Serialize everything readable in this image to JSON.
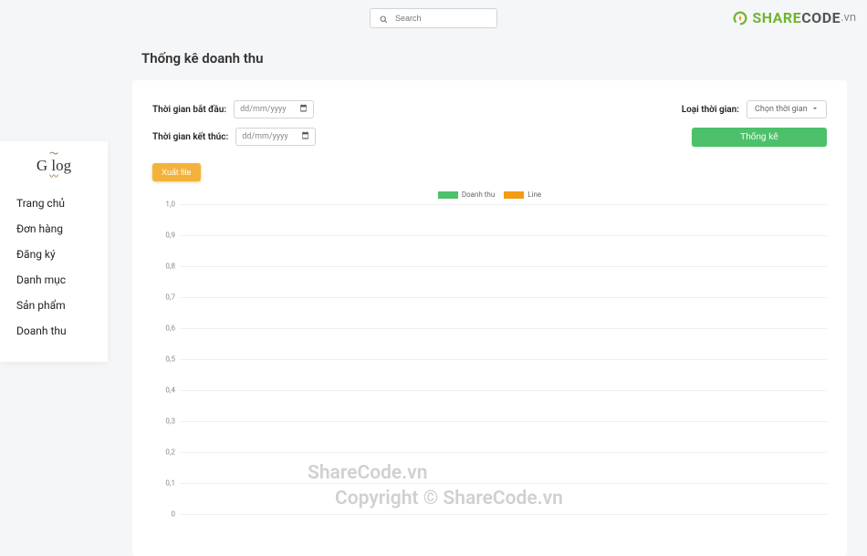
{
  "search": {
    "placeholder": "Search"
  },
  "brand": {
    "share": "SHARE",
    "code": "CODE",
    "vn": ".vn"
  },
  "page_title": "Thống kê doanh thu",
  "sidebar": {
    "logo_text": "G log",
    "items": [
      {
        "label": "Trang chủ"
      },
      {
        "label": "Đơn hàng"
      },
      {
        "label": "Đăng ký"
      },
      {
        "label": "Danh mục"
      },
      {
        "label": "Sản phẩm"
      },
      {
        "label": "Doanh thu"
      }
    ]
  },
  "filters": {
    "start_label": "Thời gian bắt đầu:",
    "end_label": "Thời gian kết thúc:",
    "date_placeholder": "dd/mm/yyyy",
    "type_label": "Loại thời gian:",
    "type_placeholder": "Chọn thời gian",
    "stat_button": "Thống kê",
    "export_button": "Xuất file"
  },
  "chart_data": {
    "type": "bar",
    "categories": [],
    "series": [
      {
        "name": "Doanh thu",
        "values": [],
        "color": "#4cc06a"
      },
      {
        "name": "Line",
        "values": [],
        "color": "#f39c12"
      }
    ],
    "title": "",
    "xlabel": "",
    "ylabel": "",
    "ylim": [
      0,
      1.0
    ],
    "yticks": [
      0,
      0.1,
      0.2,
      0.3,
      0.4,
      0.5,
      0.6,
      0.7,
      0.8,
      0.9,
      1.0
    ]
  },
  "watermarks": {
    "line1": "ShareCode.vn",
    "line2": "Copyright © ShareCode.vn"
  }
}
